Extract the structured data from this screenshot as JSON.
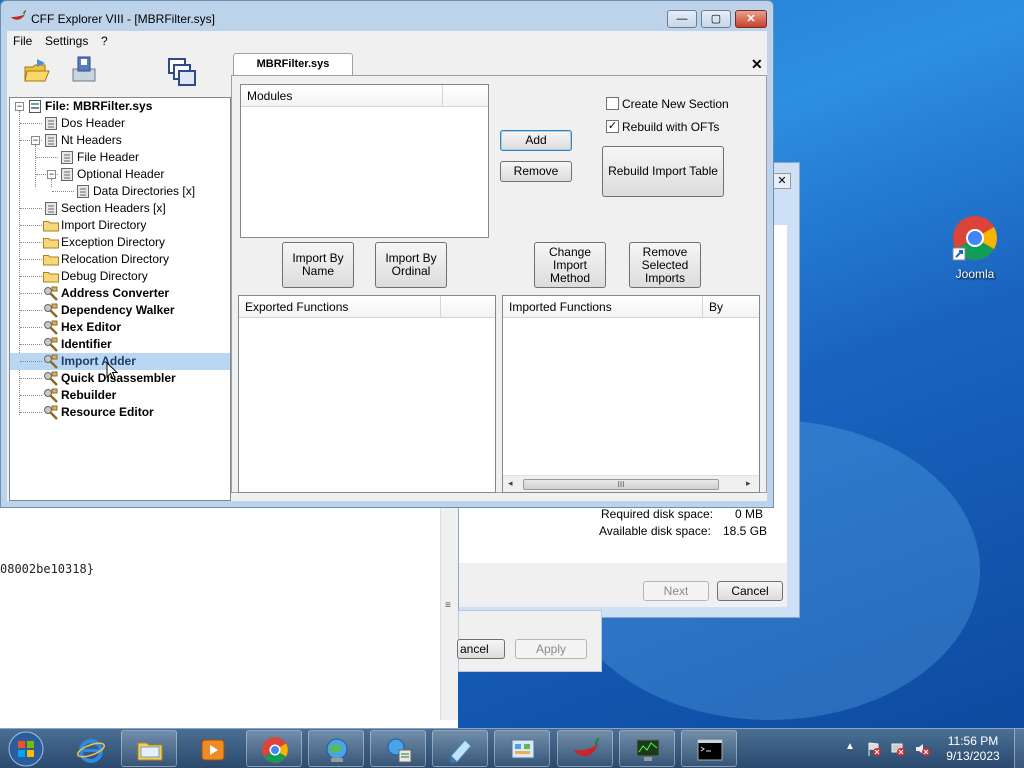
{
  "window": {
    "title": "CFF Explorer VIII - [MBRFilter.sys]",
    "caption_buttons": {
      "minimize": "—",
      "maximize": "▢",
      "close": "✕"
    }
  },
  "menu": {
    "file": "File",
    "settings": "Settings",
    "help": "?"
  },
  "tree": {
    "root": "File: MBRFilter.sys",
    "items": [
      {
        "label": "Dos Header"
      },
      {
        "label": "Nt Headers"
      },
      {
        "label": "File Header"
      },
      {
        "label": "Optional Header"
      },
      {
        "label": "Data Directories [x]"
      },
      {
        "label": "Section Headers [x]"
      },
      {
        "label": "Import Directory"
      },
      {
        "label": "Exception Directory"
      },
      {
        "label": "Relocation Directory"
      },
      {
        "label": "Debug Directory"
      },
      {
        "label": "Address Converter"
      },
      {
        "label": "Dependency Walker"
      },
      {
        "label": "Hex Editor"
      },
      {
        "label": "Identifier"
      },
      {
        "label": "Import Adder"
      },
      {
        "label": "Quick Disassembler"
      },
      {
        "label": "Rebuilder"
      },
      {
        "label": "Resource Editor"
      }
    ],
    "selected": "Import Adder"
  },
  "tab": {
    "label": "MBRFilter.sys",
    "close": "✕"
  },
  "import_adder": {
    "modules_header": "Modules",
    "create_new_section": "Create New Section",
    "create_new_section_checked": false,
    "rebuild_with_ofts": "Rebuild with OFTs",
    "rebuild_with_ofts_checked": true,
    "checkmark": "✓",
    "add": "Add",
    "remove": "Remove",
    "rebuild_import_table": "Rebuild Import Table",
    "import_by_name": "Import By\nName",
    "import_by_ordinal": "Import By\nOrdinal",
    "change_import_method": "Change\nImport\nMethod",
    "remove_selected_imports": "Remove\nSelected\nImports",
    "exported_functions": "Exported Functions",
    "imported_functions": "Imported Functions",
    "by": "By",
    "scroll_left": "◂",
    "scroll_right": "▸",
    "scroll_grip": "III"
  },
  "background": {
    "editor_text": "08002be10318}",
    "editor_grip": "≡",
    "installer_close": "✕",
    "required_disk_space_label": "Required disk space:",
    "required_disk_space_value": "0 MB",
    "available_disk_space_label": "Available disk space:",
    "available_disk_space_value": "18.5 GB",
    "next": "Next",
    "cancel": "Cancel",
    "props_cancel": "ancel",
    "props_apply": "Apply"
  },
  "desktop": {
    "shortcut_label": "Joomla"
  },
  "taskbar": {
    "clock_time": "11:56 PM",
    "clock_date": "9/13/2023",
    "tray_chevron": "▲"
  }
}
